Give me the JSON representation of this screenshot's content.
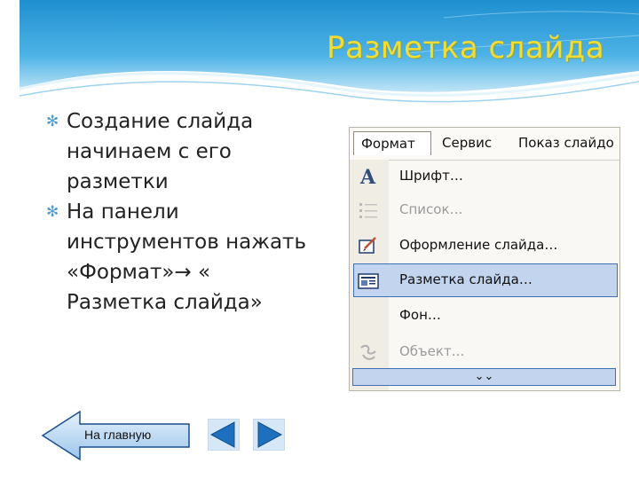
{
  "slide": {
    "title": "Разметка слайда",
    "bullets": [
      {
        "text": "Создание слайда\nначинаем с его\nразметки"
      },
      {
        "text": "На панели\nинструментов нажать\n«Формат»→ «\nРазметка слайда»"
      }
    ]
  },
  "menu": {
    "bar": [
      "Формат",
      "Сервис",
      "Показ слайдо"
    ],
    "items": [
      {
        "label": "Шрифт…",
        "icon": "font-icon",
        "enabled": true,
        "selected": false
      },
      {
        "label": "Список…",
        "icon": "list-icon",
        "enabled": false,
        "selected": false
      },
      {
        "label": "Оформление слайда…",
        "icon": "slide-design-icon",
        "enabled": true,
        "selected": false
      },
      {
        "label": "Разметка слайда…",
        "icon": "slide-layout-icon",
        "enabled": true,
        "selected": true
      },
      {
        "label": "Фон…",
        "icon": "",
        "enabled": true,
        "selected": false
      },
      {
        "label": "Объект…",
        "icon": "object-icon",
        "enabled": false,
        "selected": false
      }
    ],
    "expand_glyph": "¥"
  },
  "nav": {
    "home_label": "На главную",
    "prev": "previous-slide",
    "next": "next-slide"
  },
  "colors": {
    "title": "#f3dc34",
    "header_blue": "#2b9bd6",
    "menu_highlight": "#c2d4ee",
    "nav_blue": "#1f6fbf"
  }
}
